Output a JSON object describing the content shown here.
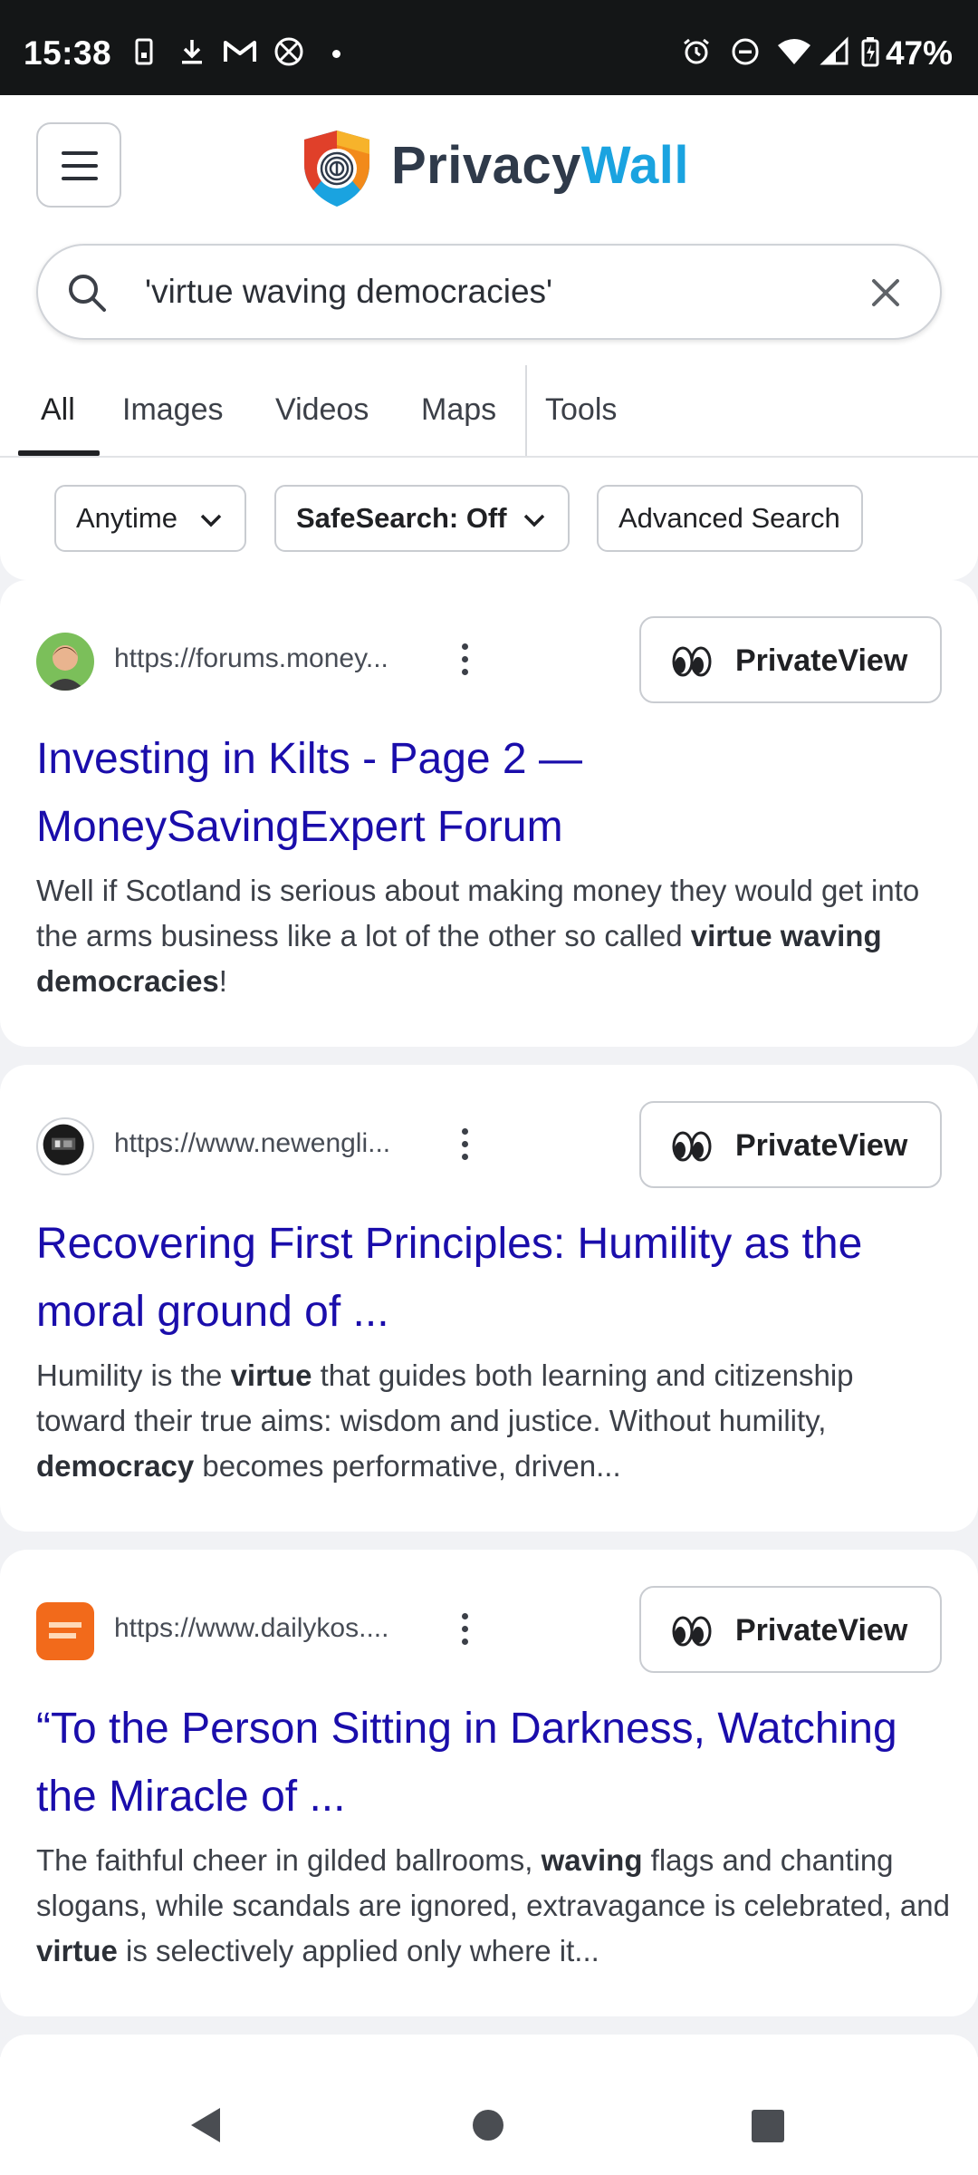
{
  "status_bar": {
    "time": "15:38",
    "battery": "47%",
    "left_icons": [
      "phone-icon",
      "download-icon",
      "gmail-icon",
      "xbox-icon"
    ],
    "right_icons": [
      "alarm-icon",
      "dnd-icon",
      "wifi-icon",
      "signal-icon",
      "battery-icon"
    ]
  },
  "header": {
    "brand_part1": "Privacy",
    "brand_part2": "Wall",
    "brand_colors": {
      "part1": "#2f3a4a",
      "part2": "#1aa3e0"
    }
  },
  "search": {
    "query": "'virtue waving democracies'"
  },
  "tabs": [
    {
      "label": "All",
      "active": true
    },
    {
      "label": "Images"
    },
    {
      "label": "Videos"
    },
    {
      "label": "Maps"
    },
    {
      "label": "Tools"
    }
  ],
  "filters": [
    {
      "label": "Anytime"
    },
    {
      "label": "SafeSearch: Off"
    },
    {
      "label": "Advanced Search"
    }
  ],
  "results": [
    {
      "url": "https://forums.money...",
      "privateview_label": "PrivateView",
      "title": "Investing in Kilts - Page 2 — MoneySavingExpert Forum",
      "snippet_parts": [
        "Well if Scotland is serious about making money they would get into the arms business like a lot of the other so called ",
        "virtue waving democracies",
        "!"
      ]
    },
    {
      "url": "https://www.newengli...",
      "privateview_label": "PrivateView",
      "title": "Recovering First Principles: Humility as the moral ground of ...",
      "snippet_parts": [
        "Humility is the ",
        "virtue",
        " that guides both learning and citizenship toward their true aims: wisdom and justice. Without humility, ",
        "democracy",
        " becomes performative, driven..."
      ]
    },
    {
      "url": "https://www.dailykos....",
      "privateview_label": "PrivateView",
      "title": "“To the Person Sitting in Darkness, Watching the Miracle of ...",
      "snippet_parts": [
        "The faithful cheer in gilded ballrooms, ",
        "waving",
        " flags and chanting slogans, while scandals are ignored, extravagance is celebrated, and ",
        "virtue",
        " is selectively applied only where it..."
      ]
    }
  ],
  "colors": {
    "link": "#1a0dab",
    "page_bg": "#f1f2f5"
  }
}
